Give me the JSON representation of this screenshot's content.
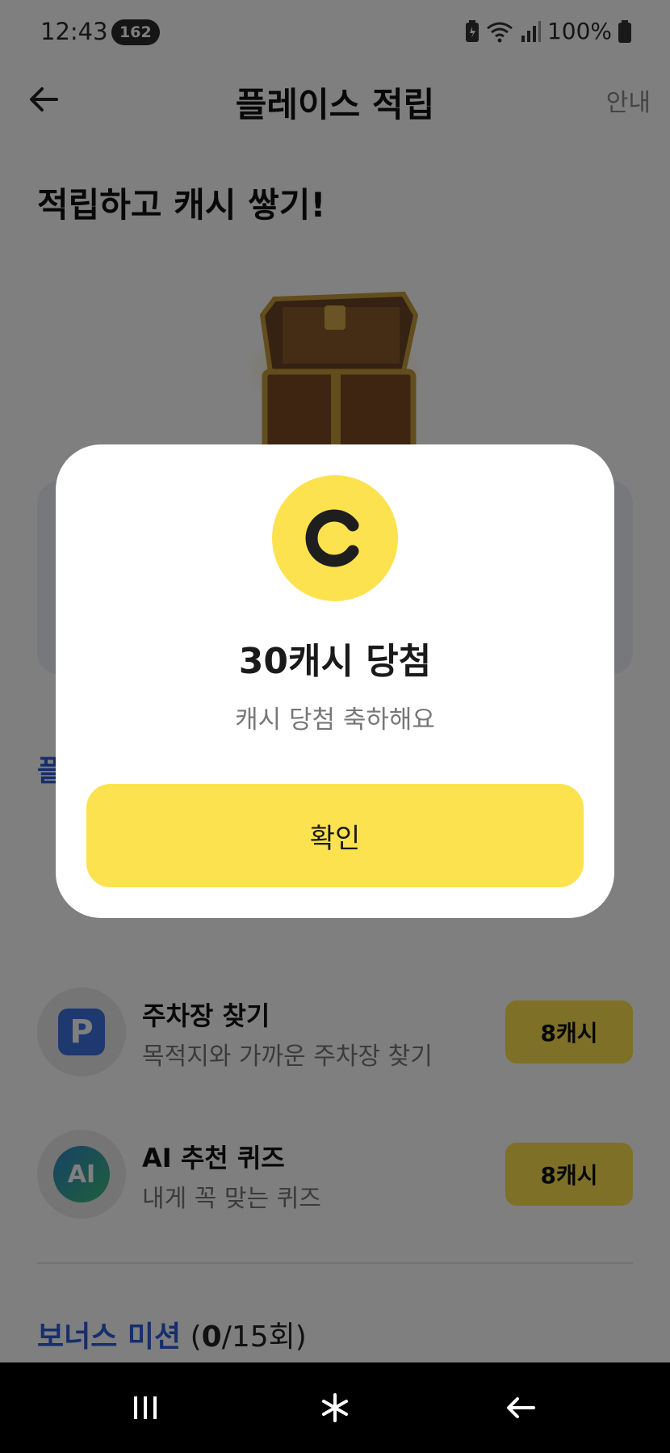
{
  "status_bar": {
    "time": "12:43",
    "notification_count": "162",
    "battery": "100%"
  },
  "header": {
    "title": "플레이스 적립",
    "guide_label": "안내",
    "back_icon": "back-arrow-icon"
  },
  "hero": {
    "heading": "적립하고 캐시 쌓기!",
    "image": "treasure-chest"
  },
  "missions": {
    "section_label": "플",
    "items": [
      {
        "title": "주차장 찾기",
        "description": "목적지와 가까운 주차장 찾기",
        "reward": "8캐시",
        "icon_text": "P",
        "icon": "parking-icon"
      },
      {
        "title": "AI 추천 퀴즈",
        "description": "내게 꼭 맞는 퀴즈",
        "reward": "8캐시",
        "icon_text": "AI",
        "icon": "ai-icon"
      }
    ]
  },
  "bonus": {
    "title": "보너스 미션",
    "open": "(",
    "done": "0",
    "rest": "/15회)"
  },
  "modal": {
    "coin_icon": "cash-coin-icon",
    "title": "30캐시 당첨",
    "subtitle": "캐시 당첨 축하해요",
    "confirm_label": "확인"
  },
  "colors": {
    "accent_yellow": "#fde24f",
    "link_blue": "#2c5fd6",
    "overlay": "rgba(0,0,0,0.5)"
  }
}
